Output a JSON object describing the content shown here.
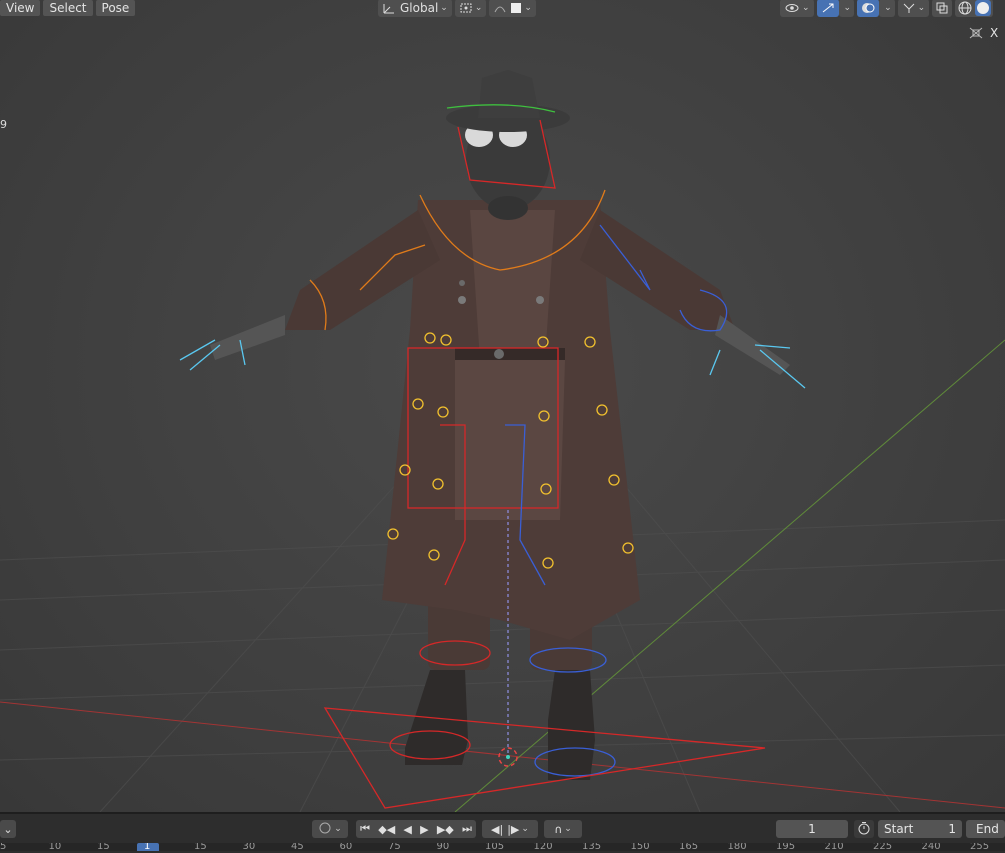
{
  "menu": {
    "view": "View",
    "select": "Select",
    "pose": "Pose"
  },
  "header": {
    "orientation": "Global",
    "close_label": "X"
  },
  "side_text": "9",
  "colors": {
    "accent": "#4772b3",
    "bone_red": "#d62828",
    "bone_blue": "#3a5fd6",
    "bone_orange": "#e07b1a",
    "bone_yellow": "#f2c12e",
    "bone_cyan": "#5ac8f0",
    "bone_green": "#3fbf3f"
  },
  "icons": [
    "transform-orientation-icon",
    "pivot-point-icon",
    "snapping-icon",
    "proportional-editing-icon",
    "visibility-icon",
    "gizmo-icon",
    "overlay-icon",
    "xray-icon",
    "wireframe-shading-icon",
    "solid-shading-icon",
    "hide-toolbar-icon"
  ],
  "timeline": {
    "current_frame": "1",
    "start_label": "Start",
    "start_value": "1",
    "end_label": "End",
    "ruler_ticks": [
      "5",
      "10",
      "15",
      "1",
      "15",
      "30",
      "45",
      "60",
      "75",
      "90",
      "105",
      "120",
      "135",
      "150",
      "165",
      "180",
      "195",
      "210",
      "225",
      "240",
      "255"
    ]
  }
}
